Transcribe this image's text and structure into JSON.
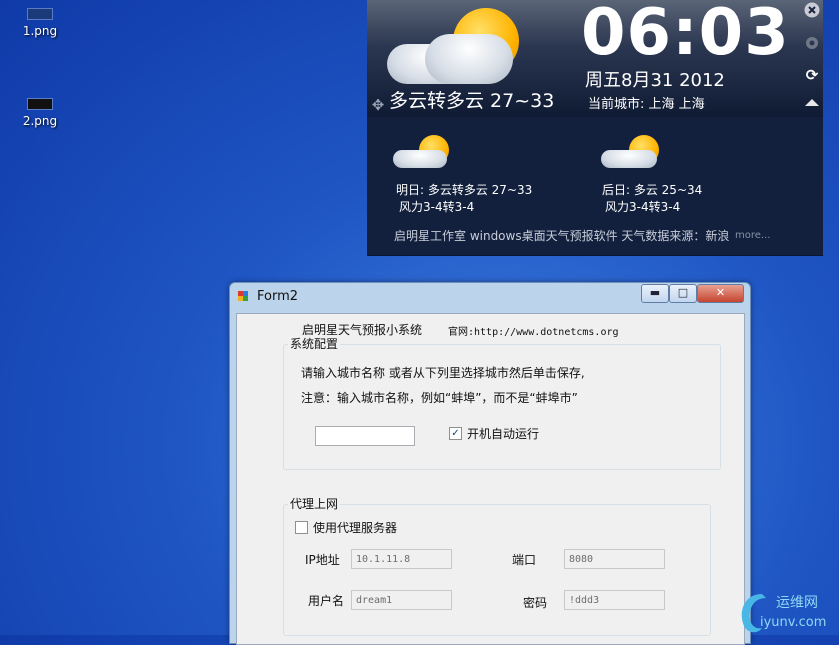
{
  "desktop": {
    "icons": [
      {
        "label": "1.png"
      },
      {
        "label": "2.png"
      }
    ]
  },
  "widget": {
    "today_condition": "多云转多云 27~33",
    "time": "06:03",
    "date": "周五8月31 2012",
    "city": "当前城市: 上海 上海",
    "tomorrow_line1": "明日: 多云转多云 27~33",
    "tomorrow_line2": "风力3-4转3-4",
    "after_line1": "后日: 多云 25~34",
    "after_line2": "风力3-4转3-4",
    "footer": "启明星工作室 windows桌面天气预报软件 天气数据来源：新浪",
    "more": "more...",
    "icons": [
      "close-icon",
      "gear-icon",
      "refresh-icon",
      "collapse-icon",
      "move-icon"
    ]
  },
  "form": {
    "title": "Form2",
    "header_app": "启明星天气预报小系统",
    "header_site": "官网:http://www.dotnetcms.org",
    "system_group": "系统配置",
    "instruction": "请输入城市名称 或者从下列里选择城市然后单击保存,",
    "note": "注意：输入城市名称，例如“蚌埠”，而不是“蚌埠市”",
    "city_value": "",
    "autostart_label": "开机自动运行",
    "autostart_checked": true,
    "proxy_group": "代理上网",
    "use_proxy_label": "使用代理服务器",
    "use_proxy_checked": false,
    "ip_label": "IP地址",
    "ip_value": "10.1.11.8",
    "port_label": "端口",
    "port_value": "8080",
    "user_label": "用户名",
    "user_value": "dream1",
    "pass_label": "密码",
    "pass_value": "!ddd3"
  },
  "watermark": {
    "text": "运维网",
    "sub": "iyunv.com"
  }
}
